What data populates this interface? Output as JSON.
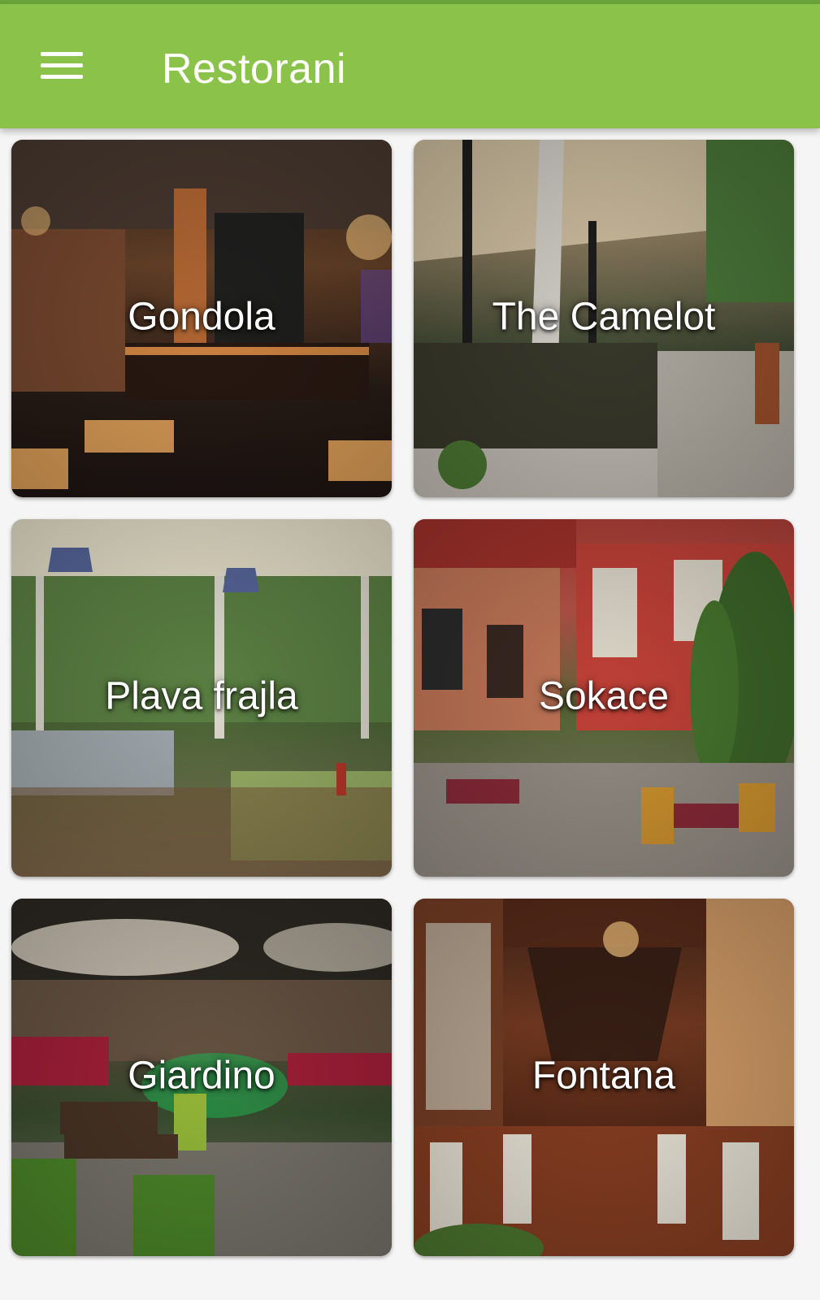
{
  "app_bar": {
    "title": "Restorani",
    "menu_icon": "hamburger-menu-icon",
    "background_color": "#8bc34a",
    "title_color": "#ffffff"
  },
  "restaurants": [
    {
      "name": "Gondola"
    },
    {
      "name": "The Camelot"
    },
    {
      "name": "Plava frajla"
    },
    {
      "name": "Sokace"
    },
    {
      "name": "Giardino"
    },
    {
      "name": "Fontana"
    }
  ]
}
